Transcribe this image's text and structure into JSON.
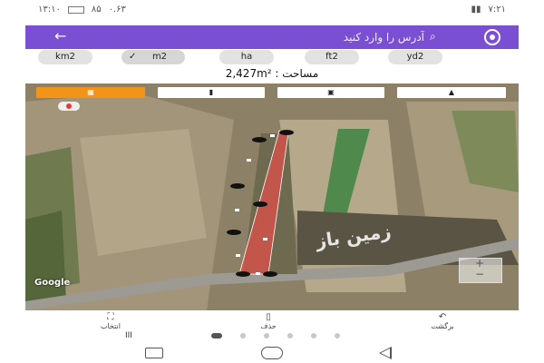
{
  "status_bar": {
    "time": "۱۳:۱۰",
    "network": "۰.۶۳",
    "battery": "۸۵",
    "right_text": "۷:۲۱"
  },
  "app_bar": {
    "search_placeholder": "آدرس را وارد کنید",
    "accent": "#7b4fd1"
  },
  "units": {
    "items": [
      {
        "label": "km2",
        "selected": false
      },
      {
        "label": "m2",
        "selected": true
      },
      {
        "label": "ha",
        "selected": false
      },
      {
        "label": "ft2",
        "selected": false
      },
      {
        "label": "yd2",
        "selected": false
      }
    ],
    "area_label": "مساحت :",
    "area_value": "2,427m²"
  },
  "map": {
    "google_logo": "Google",
    "watermark": "زمین باز",
    "polygon_color": "#e0504a",
    "buttons": [
      "active-orange",
      "plain-1",
      "plain-2",
      "plain-3"
    ]
  },
  "actions": {
    "select": "انتخاب",
    "delete": "حذف",
    "undo": "برگشت"
  },
  "icons": {
    "back": "arrow-left-icon",
    "location": "target-icon",
    "search": "search-icon",
    "check": "check-icon"
  }
}
